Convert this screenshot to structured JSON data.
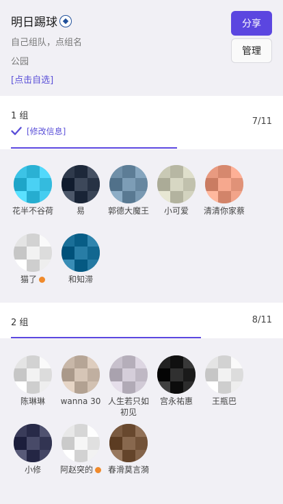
{
  "header": {
    "title": "明日踢球",
    "subtitle": "自己组队，点组名",
    "location": "公园",
    "self_select": "[点击自选]",
    "share_label": "分享",
    "manage_label": "管理"
  },
  "groups": [
    {
      "name": "1 组",
      "edit_label": "[修改信息]",
      "count": "7/11",
      "progress": 0.64,
      "members": [
        {
          "name": "花半不谷荷",
          "color": "#3cc3e6",
          "dot": false
        },
        {
          "name": "易",
          "color": "#2f3a4c",
          "dot": false
        },
        {
          "name": "郭德大魔王",
          "color": "#6f8fa8",
          "dot": false
        },
        {
          "name": "小可爱",
          "color": "#c9c9b5",
          "dot": false
        },
        {
          "name": "清清你家蔡",
          "color": "#e89a80",
          "dot": false
        },
        {
          "name": "猫了",
          "color": "#e4e4e4",
          "dot": true
        },
        {
          "name": "和知滞",
          "color": "#1a6f98",
          "dot": false
        }
      ]
    },
    {
      "name": "2 组",
      "edit_label": "",
      "count": "8/11",
      "progress": 0.73,
      "members": [
        {
          "name": "陈琳琳",
          "color": "#e4e4e4",
          "dot": false
        },
        {
          "name": "wanna 30",
          "color": "#c8b7a8",
          "dot": false
        },
        {
          "name": "人生若只如初见",
          "color": "#c7c0cc",
          "dot": false
        },
        {
          "name": "宫永祐惠",
          "color": "#222222",
          "dot": false
        },
        {
          "name": "王瓶巴",
          "color": "#e4e4e4",
          "dot": false
        },
        {
          "name": "小修",
          "color": "#3a3c5a",
          "dot": false
        },
        {
          "name": "阿赵突的",
          "color": "#e8e8e8",
          "dot": true
        },
        {
          "name": "春滑莫言漪",
          "color": "#7a5a40",
          "dot": false
        }
      ]
    }
  ],
  "colors": {
    "accent": "#5b46e0",
    "link": "#5a4fd8",
    "dot": "#f08a2c"
  },
  "icons": {
    "title_icon": "soccer-ball-icon",
    "edit_icon": "check-icon"
  }
}
